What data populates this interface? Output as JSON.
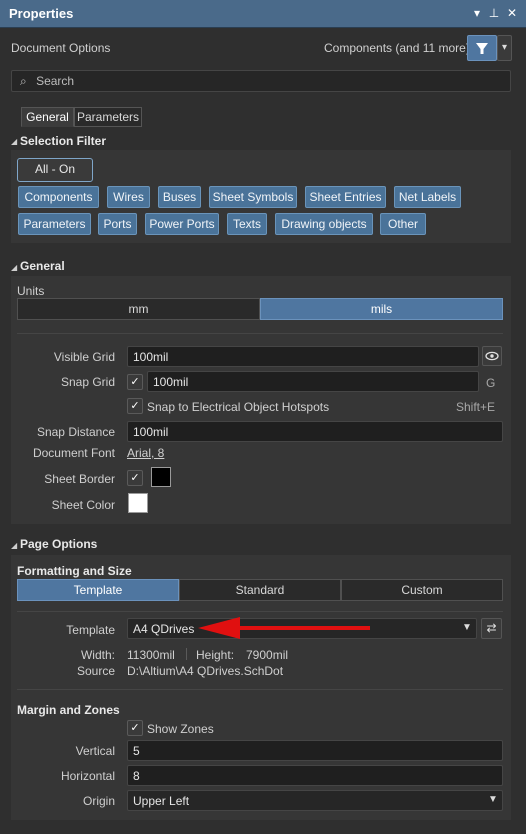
{
  "window": {
    "title": "Properties",
    "header_left": "Document Options",
    "header_right": "Components (and 11 more)"
  },
  "search": {
    "placeholder": "Search"
  },
  "tabs": [
    "General",
    "Parameters"
  ],
  "selection_filter": {
    "heading": "Selection Filter",
    "all_on": "All - On",
    "row1": [
      "Components",
      "Wires",
      "Buses",
      "Sheet Symbols",
      "Sheet Entries",
      "Net Labels"
    ],
    "row2": [
      "Parameters",
      "Ports",
      "Power Ports",
      "Texts",
      "Drawing objects",
      "Other"
    ]
  },
  "general": {
    "heading": "General",
    "units_label": "Units",
    "units": [
      "mm",
      "mils"
    ],
    "units_selected": "mils",
    "visible_grid_label": "Visible Grid",
    "visible_grid_value": "100mil",
    "snap_grid_label": "Snap Grid",
    "snap_grid_value": "100mil",
    "snap_grid_shortcut": "G",
    "snap_hotspots_label": "Snap to Electrical Object Hotspots",
    "snap_hotspots_shortcut": "Shift+E",
    "snap_distance_label": "Snap Distance",
    "snap_distance_value": "100mil",
    "document_font_label": "Document Font",
    "document_font_value": "Arial, 8",
    "sheet_border_label": "Sheet Border",
    "sheet_border_color": "#000000",
    "sheet_color_label": "Sheet Color",
    "sheet_color": "#ffffff"
  },
  "page_options": {
    "heading": "Page Options",
    "formatting_heading": "Formatting and Size",
    "modes": [
      "Template",
      "Standard",
      "Custom"
    ],
    "mode_selected": "Template",
    "template_label": "Template",
    "template_value": "A4 QDrives",
    "width_label": "Width:",
    "width_value": "11300mil",
    "height_label": "Height:",
    "height_value": "7900mil",
    "source_label": "Source",
    "source_value": "D:\\Altium\\A4 QDrives.SchDot",
    "margin_heading": "Margin and Zones",
    "show_zones_label": "Show Zones",
    "vertical_label": "Vertical",
    "vertical_value": "5",
    "horizontal_label": "Horizontal",
    "horizontal_value": "8",
    "origin_label": "Origin",
    "origin_value": "Upper Left"
  },
  "colors": {
    "accent": "#4a7399",
    "arrow": "#e01010"
  }
}
